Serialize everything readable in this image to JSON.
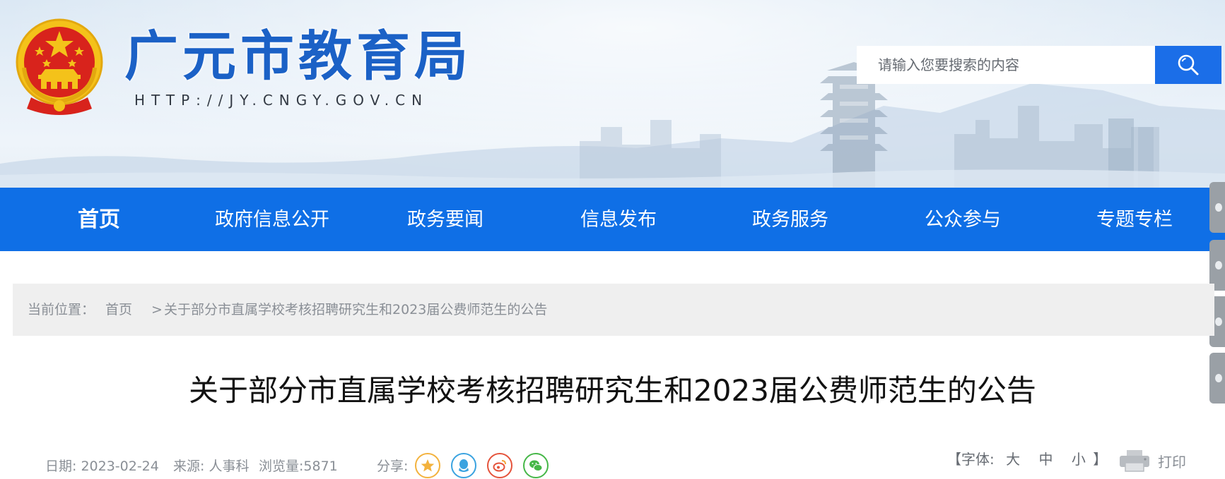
{
  "header": {
    "site_title": "广元市教育局",
    "site_url": "HTTP://JY.CNGY.GOV.CN",
    "emblem_icon": "national-emblem-icon",
    "search": {
      "placeholder": "请输入您要搜索的内容",
      "button_icon": "search-icon"
    }
  },
  "nav": {
    "items": [
      {
        "label": "首页",
        "active": true
      },
      {
        "label": "政府信息公开"
      },
      {
        "label": "政务要闻"
      },
      {
        "label": "信息发布"
      },
      {
        "label": "政务服务"
      },
      {
        "label": "公众参与"
      },
      {
        "label": "专题专栏"
      }
    ]
  },
  "breadcrumb": {
    "prefix": "当前位置：",
    "home": "首页",
    "separator": ">",
    "current": "关于部分市直属学校考核招聘研究生和2023届公费师范生的公告"
  },
  "article": {
    "title": "关于部分市直属学校考核招聘研究生和2023届公费师范生的公告",
    "date_label": "日期: 2023-02-24",
    "source_label": "来源: 人事科",
    "views_label": "浏览量:5871",
    "share_label": "分享:",
    "share_icons": [
      "qzone-icon",
      "qq-icon",
      "weibo-icon",
      "wechat-icon"
    ]
  },
  "font_size": {
    "open": "【字体:",
    "large": "大",
    "medium": "中",
    "small": "小",
    "close": "】"
  },
  "print_label": "打印",
  "colors": {
    "nav_bg": "#0f6fe6",
    "search_button": "#1b6ee8",
    "title_blue": "#1b61c6",
    "breadcrumb_bg": "#efefef",
    "emblem_red": "#d8231c",
    "emblem_gold": "#f4c21a"
  }
}
